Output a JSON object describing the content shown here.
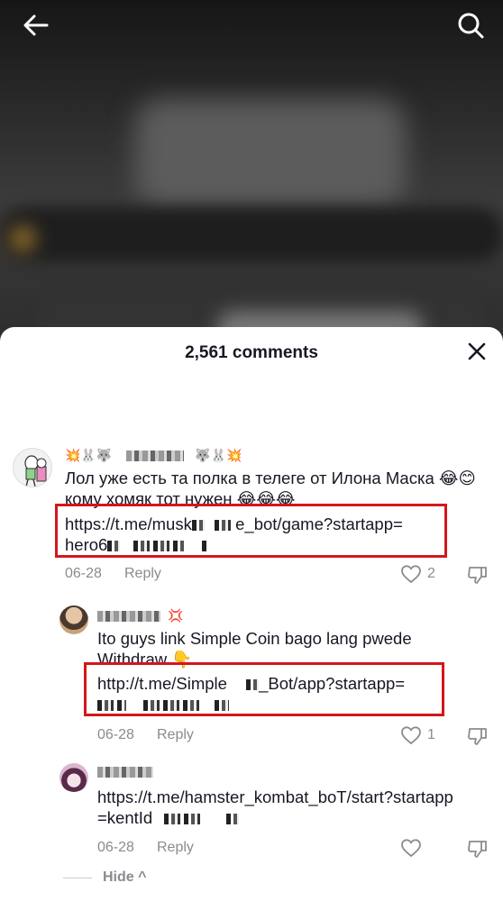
{
  "sheet": {
    "title": "2,561 comments"
  },
  "comments": [
    {
      "username_prefix": "💥🐰🐺",
      "username_suffix": "🐺🐰💥",
      "text": "Лол уже есть та полка в телеге от Илона Маска 😂😊 кому хомяк тот нужен 😂😂😂",
      "link_start": "https://t.me/musk",
      "link_mid": "e_bot/game?startapp=",
      "link_line2": "hero6",
      "date": "06-28",
      "reply_label": "Reply",
      "likes": "2"
    },
    {
      "username_suffix": "💢",
      "text": "Ito guys link Simple Coin bago lang pwede Withdraw 👇",
      "link_start": "http://t.me/Simple",
      "link_mid": "_Bot/app?startapp=",
      "date": "06-28",
      "reply_label": "Reply",
      "likes": "1"
    },
    {
      "link_line1": "https://t.me/hamster_kombat_boT/start?startapp",
      "link_line2": "=kentId",
      "date": "06-28",
      "reply_label": "Reply",
      "likes": ""
    }
  ],
  "hide_label": "Hide ^",
  "icons": {
    "back": "arrow-left-icon",
    "search": "search-icon",
    "close": "close-icon",
    "like": "heart-icon",
    "dislike": "thumbs-down-icon"
  },
  "colors": {
    "highlight": "#d4161c",
    "text": "#161823",
    "muted": "#8a8b91"
  }
}
